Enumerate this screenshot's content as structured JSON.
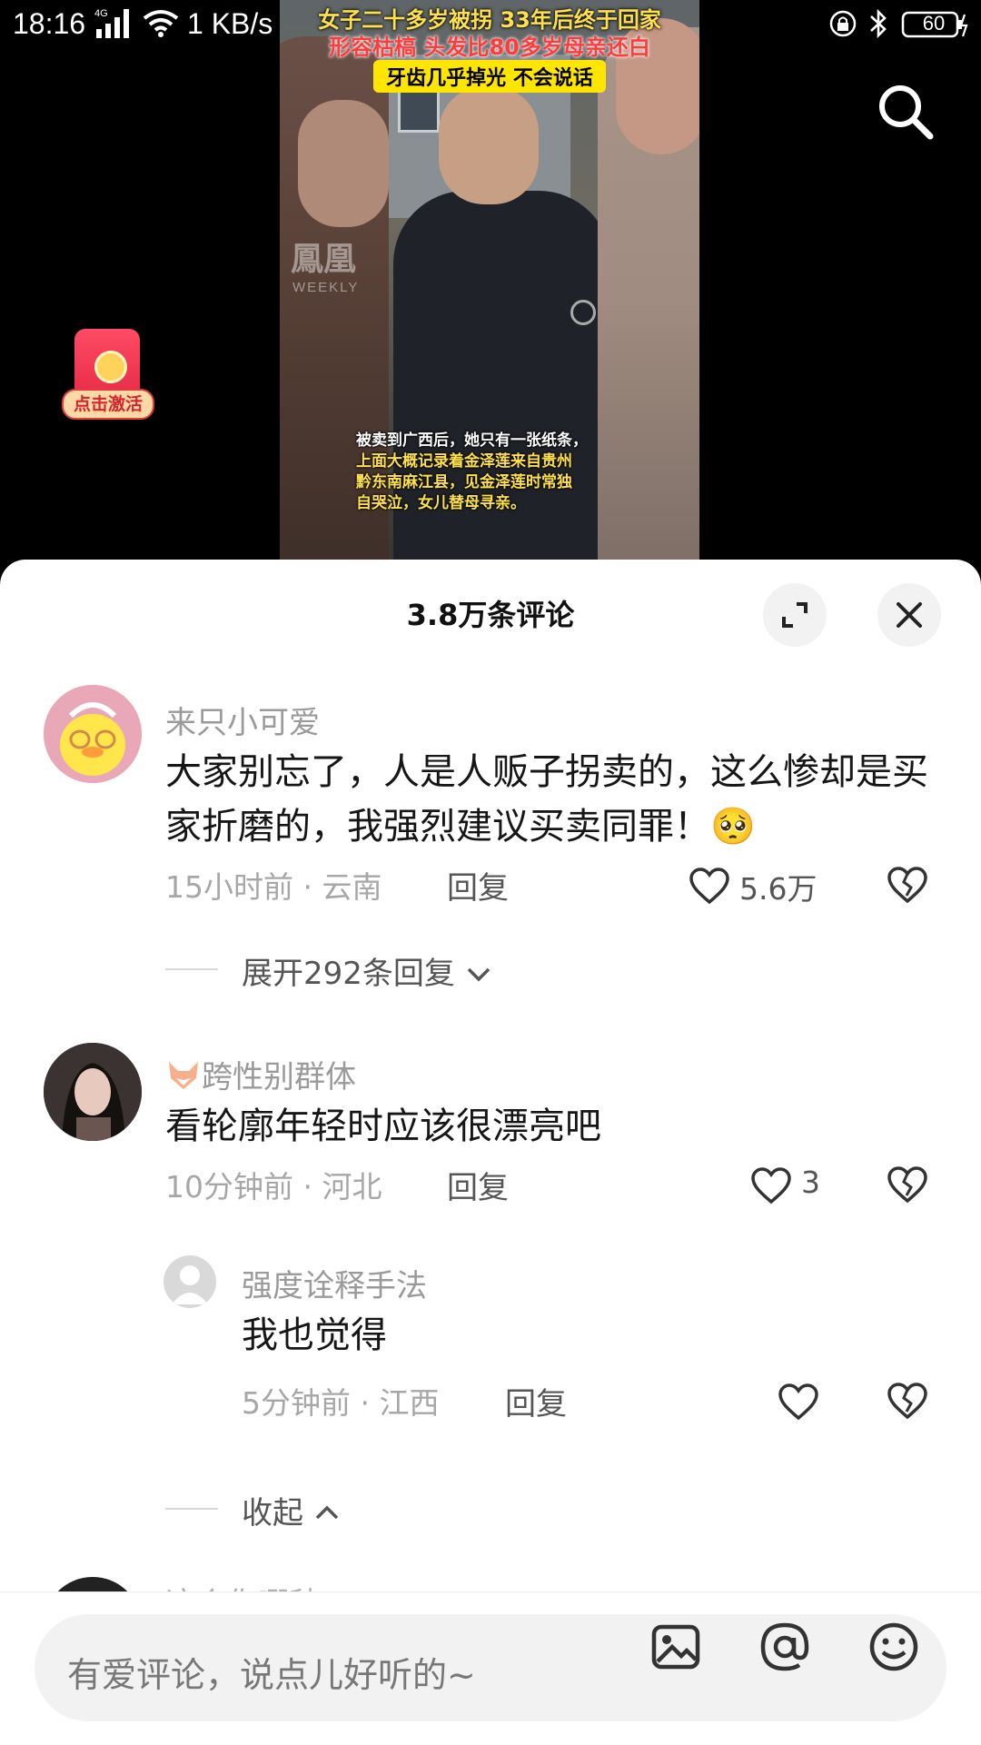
{
  "status_bar": {
    "time": "18:16",
    "network": "4G",
    "speed": "1 KB/s",
    "battery": "60"
  },
  "video": {
    "title_line1": "女子二十多岁被拐 33年后终于回家",
    "title_line2": "形容枯槁 头发比80多岁母亲还白",
    "title_line3": "牙齿几乎掉光 不会说话",
    "watermark": "鳳凰",
    "watermark_sub": "WEEKLY",
    "caption_line1": "被卖到广西后，她只有一张纸条，",
    "caption_line2": "上面大概记录着金泽莲来自贵州",
    "caption_line3": "黔东南麻江县，见金泽莲时常独",
    "caption_line4": "自哭泣，女儿替母寻亲。"
  },
  "red_packet": {
    "label": "点击激活"
  },
  "sheet": {
    "title": "3.8万条评论"
  },
  "comments": [
    {
      "username": "来只小可爱",
      "text": "大家别忘了，人是人贩子拐卖的，这么惨却是买家折磨的，我强烈建议买卖同罪！🥺",
      "time_location": "15小时前 · 云南",
      "reply_label": "回复",
      "likes": "5.6万",
      "expand_label": "展开292条回复"
    },
    {
      "username": "跨性别群体",
      "text": "看轮廓年轻时应该很漂亮吧",
      "time_location": "10分钟前 · 河北",
      "reply_label": "回复",
      "likes": "3"
    }
  ],
  "replies": [
    {
      "username": "强度诠释手法",
      "text": "我也觉得",
      "time_location": "5分钟前 · 江西",
      "reply_label": "回复"
    }
  ],
  "collapse_label": "收起",
  "next_comment_partial": "这个你哪种",
  "input": {
    "placeholder": "有爱评论，说点儿好听的~"
  },
  "icons": {
    "search": "search-icon",
    "expand": "expand-icon",
    "close": "close-icon",
    "like": "heart-icon",
    "dislike": "broken-heart-icon",
    "image": "image-icon",
    "mention": "at-icon",
    "emoji": "emoji-icon"
  }
}
